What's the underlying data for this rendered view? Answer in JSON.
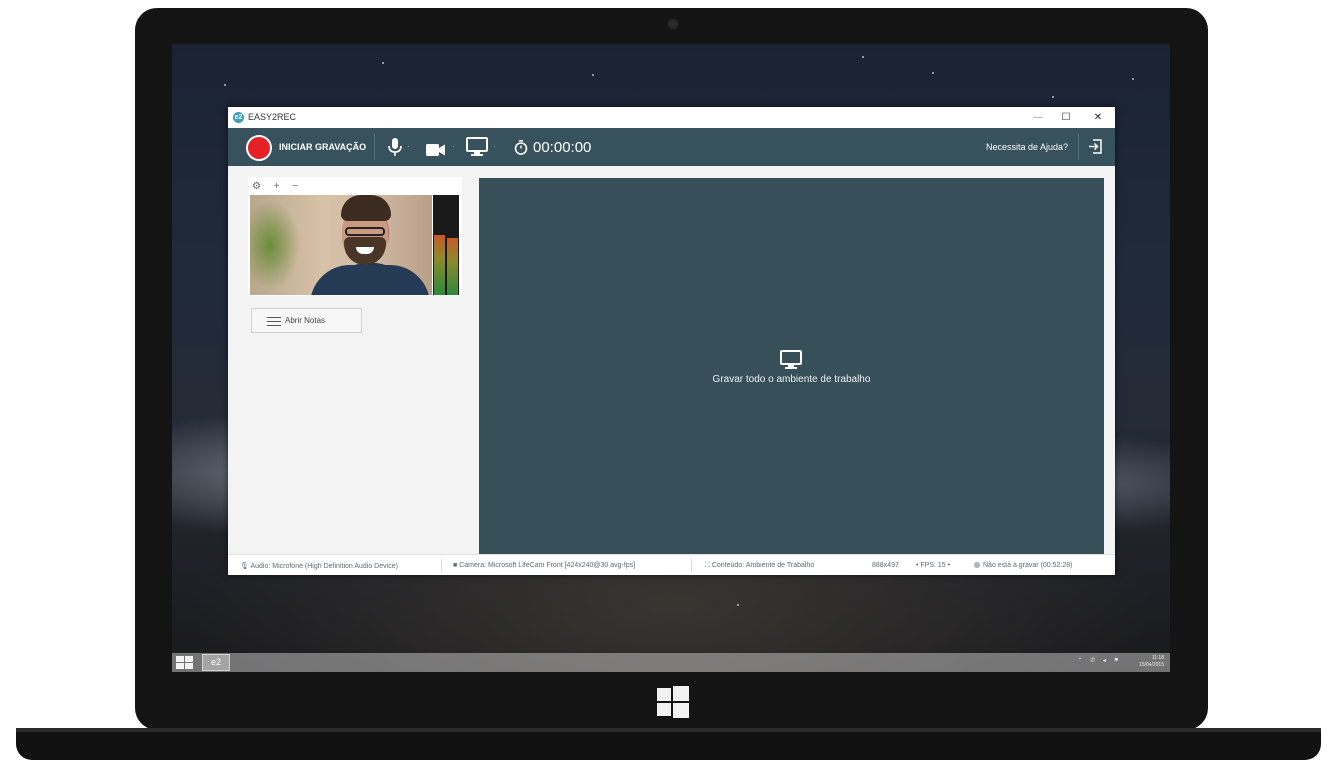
{
  "window": {
    "title": "EASY2REC",
    "logo_text": "e2",
    "minimize": "—",
    "maximize": "☐",
    "close": "✕"
  },
  "toolbar": {
    "record_label": "INICIAR GRAVAÇÃO",
    "timer": "00:00:00",
    "help_label": "Necessita de Ajuda?",
    "dropdown_glyph": "·"
  },
  "camera_panel": {
    "tools": "⚙ + −"
  },
  "notes": {
    "label": "Abrir Notas"
  },
  "preview": {
    "label": "Gravar todo o ambiente de trabalho"
  },
  "statusbar": {
    "audio": "Audio: Microfone (High Definition Audio Device)",
    "camera": "Camera: Microsoft LifeCam Front [424x240@30 avg-fps]",
    "content": "Conteúdo: Ambiente de Trabalho",
    "resolution": "888x497",
    "fps": "• FPS: 15 •",
    "recording_status": "Não está a gravar  (00:52:28)"
  },
  "taskbar": {
    "app_label": "e2",
    "tray_icons": "⌃ ✆ ◂ ⚑",
    "clock_time": "11:18",
    "clock_date": "15/04/2015"
  },
  "colors": {
    "accent": "#37525d",
    "record": "#e52126",
    "preview_bg": "#374f59"
  }
}
